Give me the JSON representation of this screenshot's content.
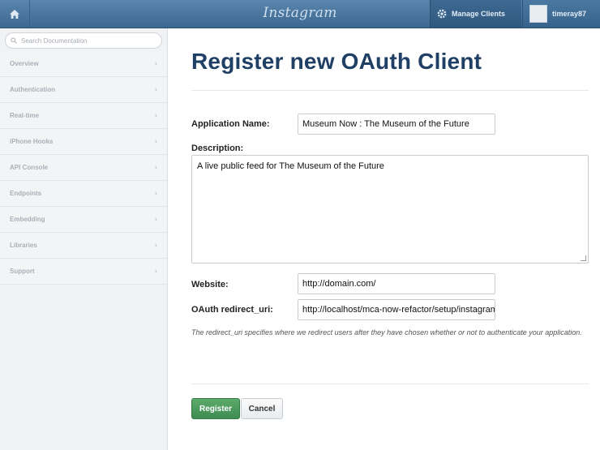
{
  "topbar": {
    "logo": "Instagram",
    "manage_label": "Manage Clients",
    "username": "timeray87"
  },
  "sidebar": {
    "search_placeholder": "Search Documentation",
    "items": [
      {
        "label": "Overview"
      },
      {
        "label": "Authentication"
      },
      {
        "label": "Real-time"
      },
      {
        "label": "iPhone Hooks"
      },
      {
        "label": "API Console"
      },
      {
        "label": "Endpoints"
      },
      {
        "label": "Embedding"
      },
      {
        "label": "Libraries"
      },
      {
        "label": "Support"
      }
    ]
  },
  "form": {
    "title": "Register new OAuth Client",
    "app_name_label": "Application Name:",
    "app_name_value": "Museum Now : The Museum of the Future",
    "description_label": "Description:",
    "description_value": "A live public feed for The Museum of the Future",
    "website_label": "Website:",
    "website_value": "http://domain.com/",
    "redirect_label": "OAuth redirect_uri:",
    "redirect_value": "http://localhost/mca-now-refactor/setup/instagram",
    "note": "The redirect_uri specifies where we redirect users after they have chosen whether or not to authenticate your application.",
    "register_label": "Register",
    "cancel_label": "Cancel"
  }
}
